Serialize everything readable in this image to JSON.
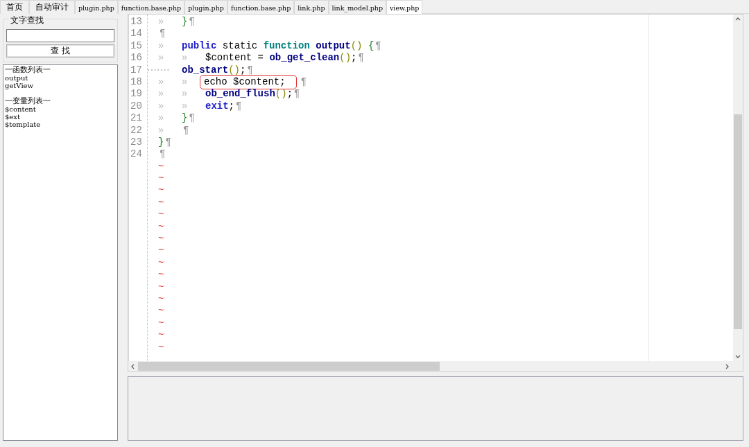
{
  "tabs": [
    {
      "label": "首页",
      "selected": false
    },
    {
      "label": "自动审计",
      "selected": false
    },
    {
      "label": "plugin.php",
      "selected": false
    },
    {
      "label": "function.base.php",
      "selected": false
    },
    {
      "label": "plugin.php",
      "selected": false
    },
    {
      "label": "function.base.php",
      "selected": false
    },
    {
      "label": "link.php",
      "selected": false
    },
    {
      "label": "link_model.php",
      "selected": false
    },
    {
      "label": "view.php",
      "selected": true
    }
  ],
  "search": {
    "title": "文字查找",
    "button": "查 找"
  },
  "outline": [
    {
      "title": "一函数列表一",
      "items": [
        "output",
        "getView"
      ]
    },
    {
      "title": "一变量列表一",
      "items": [
        "$content",
        "$ext",
        "$template"
      ]
    }
  ],
  "editor": {
    "lines": [
      {
        "number": "13",
        "indent": [
          "»"
        ],
        "tokens": [
          {
            "text": "}",
            "kind": "brace"
          }
        ],
        "eol": "¶",
        "boxed": false
      },
      {
        "number": "14",
        "eol": "¶",
        "boxed": false
      },
      {
        "number": "15",
        "indent": [
          "»"
        ],
        "tokens": [
          {
            "text": "public",
            "kind": "keyword"
          },
          {
            "text": " static ",
            "kind": "plain"
          },
          {
            "text": "function",
            "kind": "type"
          },
          {
            "text": " output",
            "kind": "name"
          },
          {
            "text": "()",
            "kind": "paren"
          },
          {
            "text": " {",
            "kind": "brace"
          }
        ],
        "eol": "¶",
        "boxed": false
      },
      {
        "number": "16",
        "indent": [
          "»",
          "»"
        ],
        "tokens": [
          {
            "text": "$content = ",
            "kind": "plain"
          },
          {
            "text": "ob_get_clean",
            "kind": "name"
          },
          {
            "text": "()",
            "kind": "paren"
          },
          {
            "text": ";",
            "kind": "plain"
          }
        ],
        "eol": "¶",
        "boxed": false
      },
      {
        "number": "17",
        "indent": [
          "·······"
        ],
        "tokens": [
          {
            "text": "ob_start",
            "kind": "name"
          },
          {
            "text": "()",
            "kind": "paren"
          },
          {
            "text": ";",
            "kind": "plain"
          }
        ],
        "eol": "¶",
        "boxed": false
      },
      {
        "number": "18",
        "indent": [
          "»",
          "»"
        ],
        "tokens": [
          {
            "text": "echo $content;",
            "kind": "plain"
          }
        ],
        "eol": "¶",
        "boxed": true
      },
      {
        "number": "19",
        "indent": [
          "»",
          "»"
        ],
        "tokens": [
          {
            "text": "ob_end_flush",
            "kind": "name"
          },
          {
            "text": "()",
            "kind": "paren"
          },
          {
            "text": ";",
            "kind": "plain"
          }
        ],
        "eol": "¶",
        "boxed": false
      },
      {
        "number": "20",
        "indent": [
          "»",
          "»"
        ],
        "tokens": [
          {
            "text": "exit",
            "kind": "keyword"
          },
          {
            "text": ";",
            "kind": "plain"
          }
        ],
        "eol": "¶",
        "boxed": false
      },
      {
        "number": "21",
        "indent": [
          "»"
        ],
        "tokens": [
          {
            "text": "}",
            "kind": "brace"
          }
        ],
        "eol": "¶",
        "boxed": false
      },
      {
        "number": "22",
        "indent": [
          "»"
        ],
        "eol": "¶",
        "boxed": false
      },
      {
        "number": "23",
        "tokens": [
          {
            "text": "}",
            "kind": "brace"
          }
        ],
        "eol": "¶",
        "boxed": false
      },
      {
        "number": "24",
        "eol": "¶",
        "boxed": false
      }
    ],
    "filler": [
      "~",
      "~",
      "~",
      "~",
      "~",
      "~",
      "~",
      "~",
      "~",
      "~",
      "~",
      "~",
      "~",
      "~",
      "~",
      "~"
    ]
  }
}
